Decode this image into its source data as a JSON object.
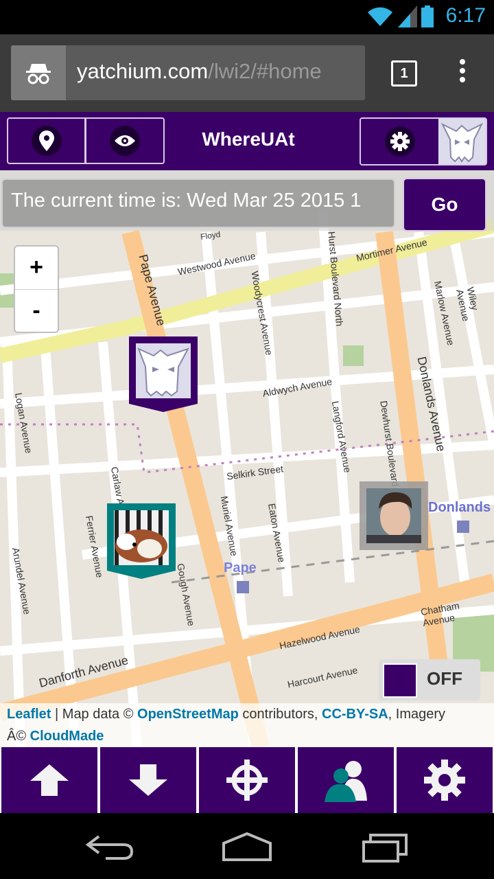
{
  "status_bar": {
    "time": "6:17",
    "icons": [
      "wifi-icon",
      "signal-icon",
      "battery-icon"
    ]
  },
  "browser": {
    "url_host": "yatchium.com",
    "url_path": "/lwi2/#home",
    "tab_count": "1"
  },
  "app": {
    "title": "WhereUAt",
    "header_buttons": [
      "location-pin-icon",
      "eye-icon",
      "gear-icon"
    ]
  },
  "time_field": {
    "value": "The current time is: Wed Mar 25 2015 1"
  },
  "go_button": "Go",
  "zoom": {
    "in": "+",
    "out": "-"
  },
  "map": {
    "streets": [
      "Mortimer Avenue",
      "Westwood Avenue",
      "Pape Avenue",
      "Woodycrest Avenue",
      "Hurst Boulevard North",
      "Marlow Avenue",
      "Wiley Avenue",
      "Donlands Avenue",
      "Aldwych Avenue",
      "Logan Avenue",
      "Selkirk Street",
      "Langford Avenue",
      "Dewhurst Boulevard",
      "Carlaw Avenue",
      "Ferrier Avenue",
      "Muriel Avenue",
      "Eaton Avenue",
      "Gough Avenue",
      "Arundel Avenue",
      "Danforth Avenue",
      "Hazelwood Avenue",
      "Harcourt Avenue",
      "Chatham Avenue",
      "Floyd"
    ],
    "stations": [
      "Pape",
      "Donlands"
    ]
  },
  "toggle": {
    "label": "OFF"
  },
  "attribution": {
    "leaflet": "Leaflet",
    "text1": " | Map data © ",
    "osm": "OpenStreetMap",
    "text2": " contributors, ",
    "license": "CC-BY-SA",
    "text3": ", Imagery",
    "text4": "Â© ",
    "cloudmade": "CloudMade"
  },
  "footer": [
    "arrow-up-icon",
    "arrow-down-icon",
    "crosshair-icon",
    "people-icon",
    "settings-cog-icon"
  ],
  "colors": {
    "brand": "#3b0068",
    "accent": "#008080",
    "link": "#0078a8"
  }
}
